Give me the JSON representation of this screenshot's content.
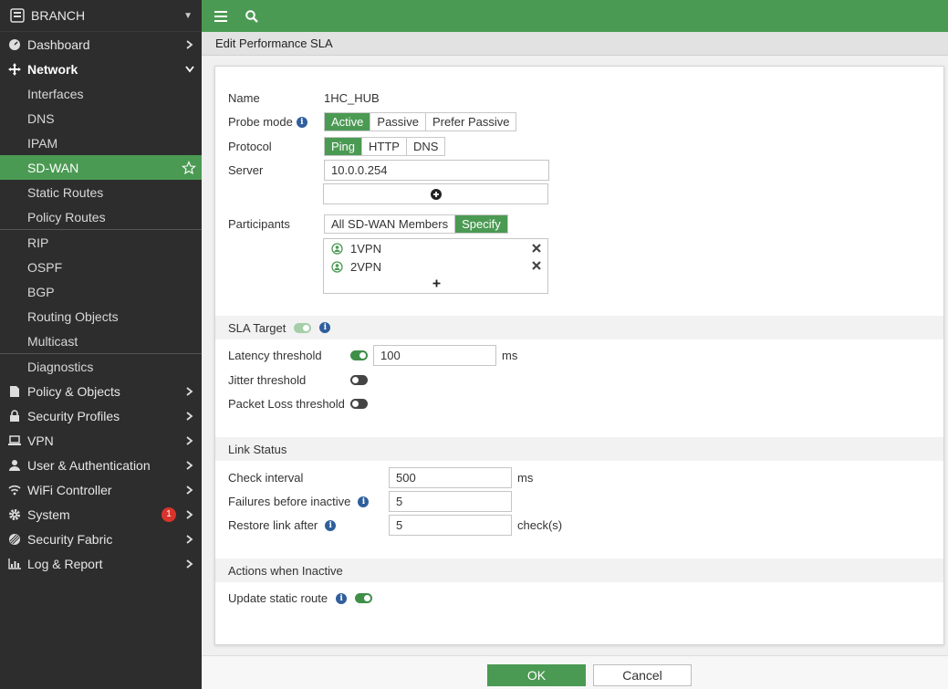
{
  "sidebar": {
    "brand": "BRANCH",
    "items": [
      {
        "label": "Dashboard"
      },
      {
        "label": "Network"
      },
      {
        "label": "Interfaces"
      },
      {
        "label": "DNS"
      },
      {
        "label": "IPAM"
      },
      {
        "label": "SD-WAN"
      },
      {
        "label": "Static Routes"
      },
      {
        "label": "Policy Routes"
      },
      {
        "label": "RIP"
      },
      {
        "label": "OSPF"
      },
      {
        "label": "BGP"
      },
      {
        "label": "Routing Objects"
      },
      {
        "label": "Multicast"
      },
      {
        "label": "Diagnostics"
      },
      {
        "label": "Policy & Objects"
      },
      {
        "label": "Security Profiles"
      },
      {
        "label": "VPN"
      },
      {
        "label": "User & Authentication"
      },
      {
        "label": "WiFi Controller"
      },
      {
        "label": "System",
        "badge": "1"
      },
      {
        "label": "Security Fabric"
      },
      {
        "label": "Log & Report"
      }
    ]
  },
  "page": {
    "title": "Edit Performance SLA"
  },
  "form": {
    "name_label": "Name",
    "name_value": "1HC_HUB",
    "probe_mode_label": "Probe mode",
    "probe_modes": [
      "Active",
      "Passive",
      "Prefer Passive"
    ],
    "protocol_label": "Protocol",
    "protocols": [
      "Ping",
      "HTTP",
      "DNS"
    ],
    "server_label": "Server",
    "server_value": "10.0.0.254",
    "participants_label": "Participants",
    "participant_modes": [
      "All SD-WAN Members",
      "Specify"
    ],
    "participants": [
      "1VPN",
      "2VPN"
    ]
  },
  "sla_target": {
    "heading": "SLA Target",
    "latency_label": "Latency threshold",
    "latency_value": "100",
    "latency_unit": "ms",
    "jitter_label": "Jitter threshold",
    "packet_loss_label": "Packet Loss threshold"
  },
  "link_status": {
    "heading": "Link Status",
    "check_interval_label": "Check interval",
    "check_interval_value": "500",
    "check_interval_unit": "ms",
    "failures_label": "Failures before inactive",
    "failures_value": "5",
    "restore_label": "Restore link after",
    "restore_value": "5",
    "restore_unit": "check(s)"
  },
  "actions": {
    "heading": "Actions when Inactive",
    "update_static_route_label": "Update static route"
  },
  "footer": {
    "ok_label": "OK",
    "cancel_label": "Cancel"
  },
  "colors": {
    "accent": "#4b9a53",
    "sidebar_bg": "#2d2d2d",
    "info": "#2f5f9c",
    "badge": "#d9342b"
  }
}
